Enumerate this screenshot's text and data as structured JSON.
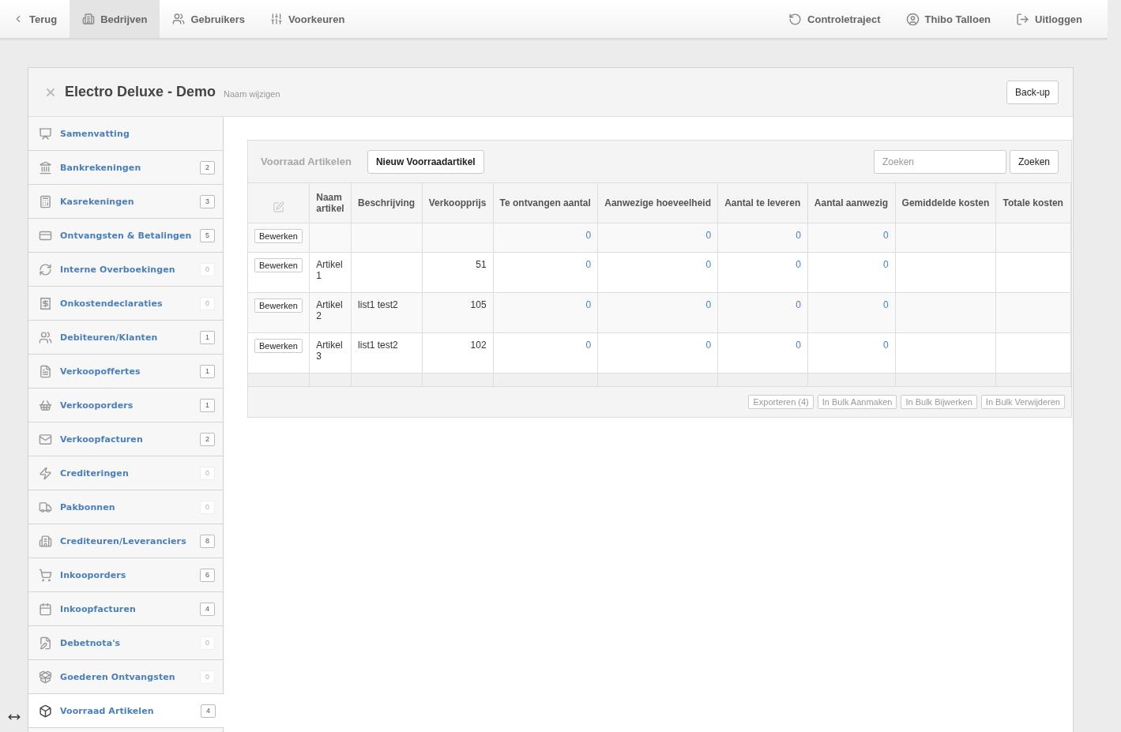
{
  "topnav": {
    "left": [
      {
        "label": "Terug",
        "selected": false
      },
      {
        "label": "Bedrijven",
        "selected": true
      },
      {
        "label": "Gebruikers",
        "selected": false
      },
      {
        "label": "Voorkeuren",
        "selected": false
      }
    ],
    "right": [
      {
        "label": "Controletraject"
      },
      {
        "label": "Thibo Talloen"
      },
      {
        "label": "Uitloggen"
      }
    ]
  },
  "panel": {
    "title": "Electro Deluxe - Demo",
    "rename_link": "Naam wijzigen",
    "backup_button": "Back-up"
  },
  "sidebar": {
    "items": [
      {
        "label": "Samenvatting",
        "selected": false
      },
      {
        "label": "Bankrekeningen",
        "count": "2",
        "dimmed": false,
        "selected": false
      },
      {
        "label": "Kasrekeningen",
        "count": "3",
        "dimmed": false,
        "selected": false
      },
      {
        "label": "Ontvangsten & Betalingen",
        "count": "5",
        "dimmed": false,
        "selected": false
      },
      {
        "label": "Interne Overboekingen",
        "count": "0",
        "dimmed": true,
        "selected": false
      },
      {
        "label": "Onkostendeclaraties",
        "count": "0",
        "dimmed": true,
        "selected": false
      },
      {
        "label": "Debiteuren/Klanten",
        "count": "1",
        "dimmed": false,
        "selected": false
      },
      {
        "label": "Verkoopoffertes",
        "count": "1",
        "dimmed": false,
        "selected": false
      },
      {
        "label": "Verkooporders",
        "count": "1",
        "dimmed": false,
        "selected": false
      },
      {
        "label": "Verkoopfacturen",
        "count": "2",
        "dimmed": false,
        "selected": false
      },
      {
        "label": "Crediteringen",
        "count": "0",
        "dimmed": true,
        "selected": false
      },
      {
        "label": "Pakbonnen",
        "count": "0",
        "dimmed": true,
        "selected": false
      },
      {
        "label": "Crediteuren/Leveranciers",
        "count": "8",
        "dimmed": false,
        "selected": false
      },
      {
        "label": "Inkooporders",
        "count": "6",
        "dimmed": false,
        "selected": false
      },
      {
        "label": "Inkoopfacturen",
        "count": "4",
        "dimmed": false,
        "selected": false
      },
      {
        "label": "Debetnota's",
        "count": "0",
        "dimmed": true,
        "selected": false
      },
      {
        "label": "Goederen Ontvangsten",
        "count": "0",
        "dimmed": true,
        "selected": false
      },
      {
        "label": "Voorraad Artikelen",
        "count": "4",
        "dimmed": false,
        "selected": true
      }
    ]
  },
  "table_panel": {
    "title": "Voorraad Artikelen",
    "new_button": "Nieuw Voorraadartikel",
    "search": {
      "placeholder": "Zoeken"
    },
    "search_button": "Zoeken",
    "columns": [
      "Naam artikel",
      "Beschrijving",
      "Verkoopprijs",
      "Te ontvangen aantal",
      "Aanwezige hoeveelheid",
      "Aantal te leveren",
      "Aantal aanwezig",
      "Gemiddelde kosten",
      "Totale kosten"
    ],
    "rows": [
      {
        "edit_button": "Bewerken",
        "cells": [
          null,
          null,
          null,
          "0",
          "0",
          "0",
          "0",
          null,
          null
        ]
      },
      {
        "edit_button": "Bewerken",
        "cells": [
          "Artikel 1",
          null,
          "51",
          "0",
          "0",
          "0",
          "0",
          null,
          null
        ]
      },
      {
        "edit_button": "Bewerken",
        "cells": [
          "Artikel 2",
          "list1 test2",
          "105",
          "0",
          "0",
          "0",
          "0",
          null,
          null
        ]
      },
      {
        "edit_button": "Bewerken",
        "cells": [
          "Artikel 3",
          "list1 test2",
          "102",
          "0",
          "0",
          "0",
          "0",
          null,
          null
        ]
      }
    ],
    "footer_buttons": [
      "Exporteren (4)",
      "In Bulk Aanmaken",
      "In Bulk Bijwerken",
      "In Bulk Verwijderen"
    ]
  }
}
